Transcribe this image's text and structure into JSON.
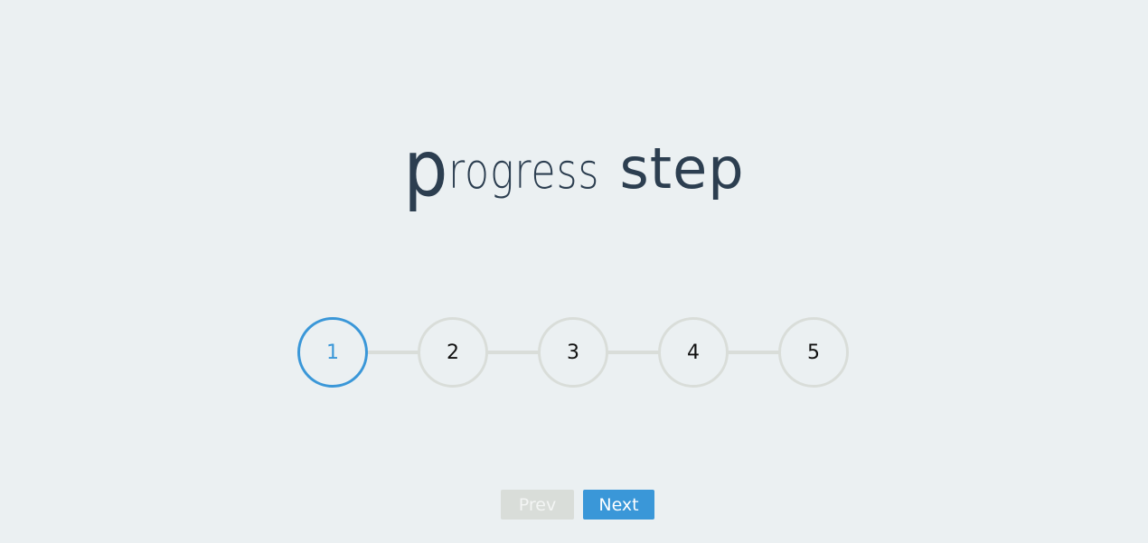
{
  "title": {
    "first_letter": "p",
    "rest": "rogress",
    "bold": "step"
  },
  "steps": [
    {
      "label": "1",
      "active": true
    },
    {
      "label": "2",
      "active": false
    },
    {
      "label": "3",
      "active": false
    },
    {
      "label": "4",
      "active": false
    },
    {
      "label": "5",
      "active": false
    }
  ],
  "buttons": {
    "prev_label": "Prev",
    "next_label": "Next",
    "prev_disabled": true
  },
  "colors": {
    "accent": "#3a97d8",
    "inactive": "#d9ddd9",
    "background": "#ebf0f2",
    "title": "#2c3e50"
  }
}
